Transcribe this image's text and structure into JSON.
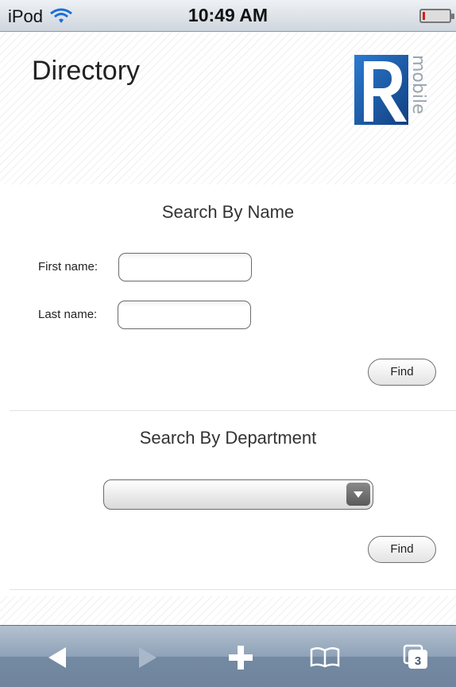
{
  "status_bar": {
    "carrier": "iPod",
    "time": "10:49 AM",
    "battery_level": 0.1
  },
  "header": {
    "title": "Directory",
    "logo_text": "mobile",
    "logo_letter": "R"
  },
  "search_by_name": {
    "heading": "Search By Name",
    "first_name_label": "First name:",
    "first_name_value": "",
    "last_name_label": "Last name:",
    "last_name_value": "",
    "find_label": "Find"
  },
  "search_by_department": {
    "heading": "Search By Department",
    "selected_department": "",
    "find_label": "Find"
  },
  "toolbar": {
    "tab_count": "3",
    "icons": [
      "back-icon",
      "forward-icon",
      "add-icon",
      "bookmarks-icon",
      "tabs-icon"
    ]
  },
  "colors": {
    "logo_blue": "#1c5fa8",
    "toolbar_blue": "#8fa2b8"
  }
}
